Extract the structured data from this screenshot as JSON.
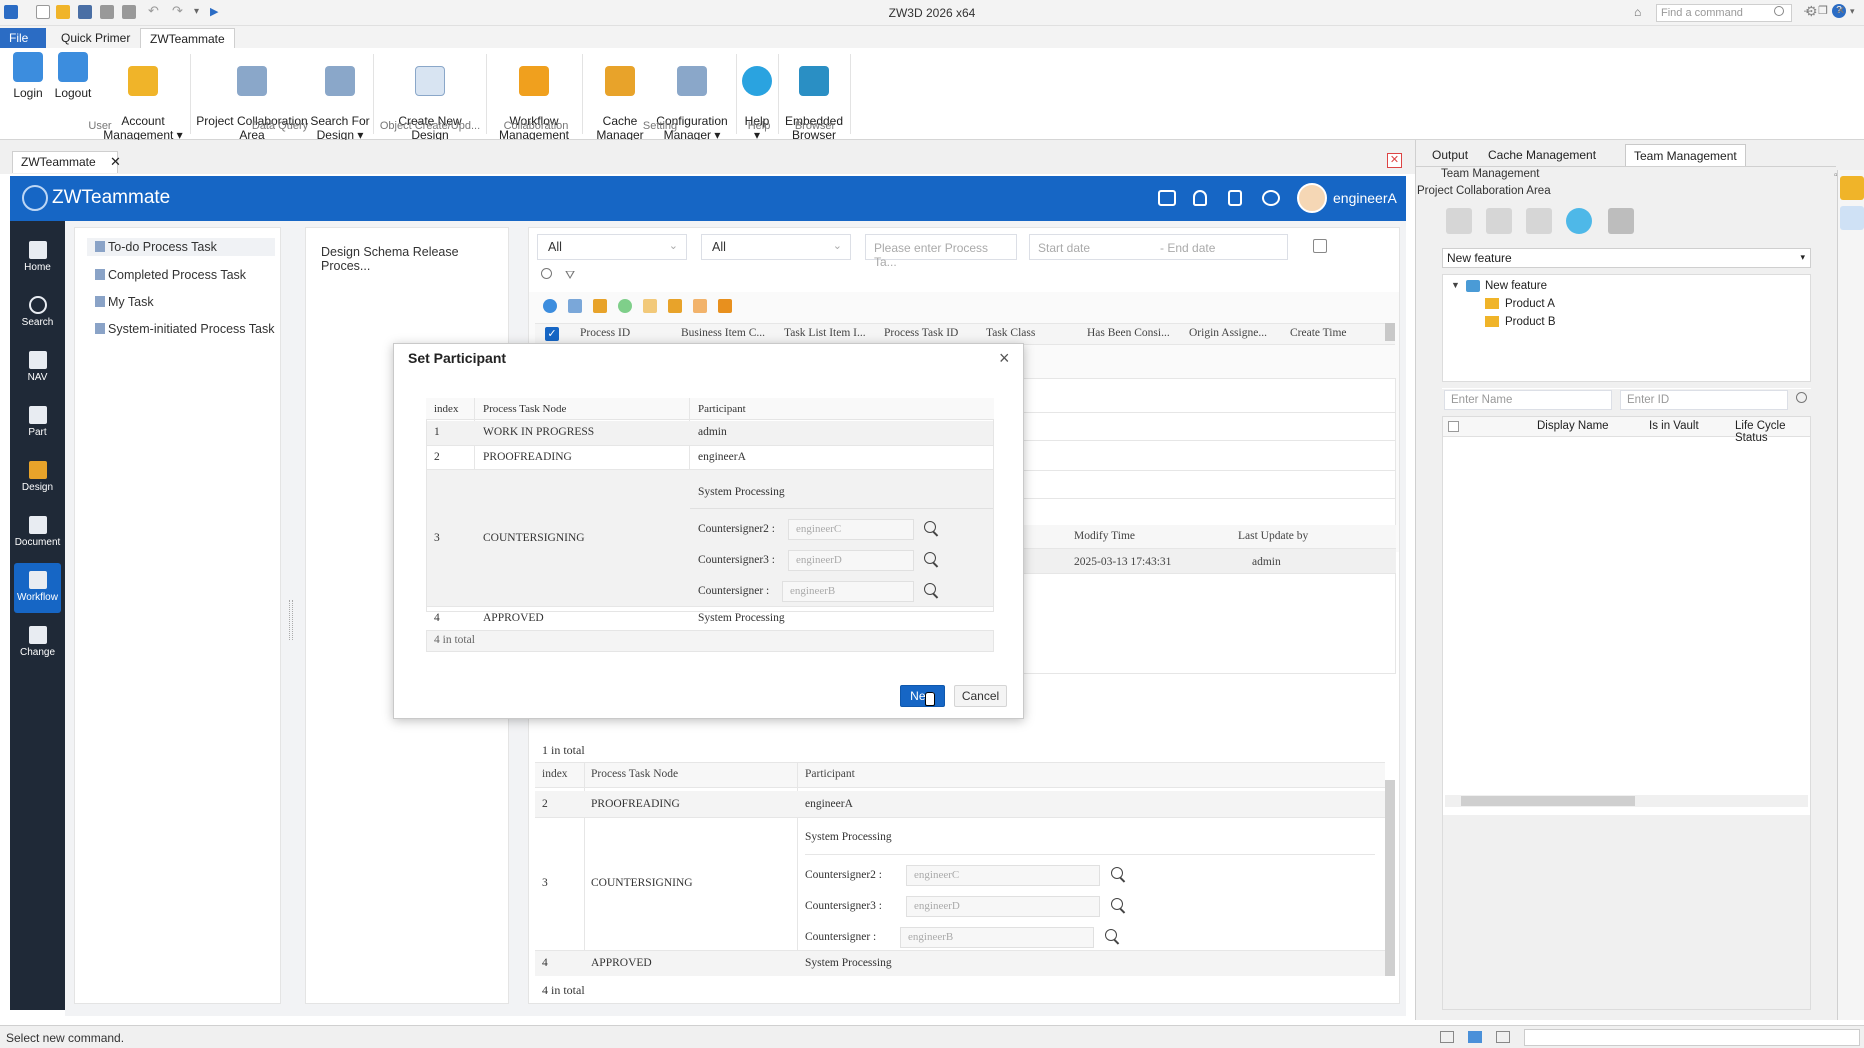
{
  "window": {
    "title": "ZW3D 2026  x64",
    "find_placeholder": "Find a command"
  },
  "menu_tabs": [
    "File",
    "Quick Primer",
    "ZWTeammate"
  ],
  "ribbon": {
    "buttons": [
      {
        "label": "Login"
      },
      {
        "label": "Logout"
      },
      {
        "label": "Account\nManagement ▾"
      },
      {
        "label": "Project Collaboration\nArea"
      },
      {
        "label": "Search For\nDesign ▾"
      },
      {
        "label": "Create New Design\nFrom Template"
      },
      {
        "label": "Workflow\nManagement"
      },
      {
        "label": "Cache\nManager"
      },
      {
        "label": "Configuration\nManager ▾"
      },
      {
        "label": "Help\n▾"
      },
      {
        "label": "Embedded\nBrowser"
      }
    ],
    "groups": [
      "User",
      "Data Query",
      "Object Create/Upd...",
      "Collaboration",
      "Setting",
      "Help",
      "Browser"
    ]
  },
  "doc_tab": {
    "label": "ZWTeammate",
    "close": "✕"
  },
  "app": {
    "name": "ZWTeammate",
    "user": "engineerA"
  },
  "nav": [
    "Home",
    "Search",
    "NAV",
    "Part",
    "Design",
    "Document",
    "Workflow",
    "Change"
  ],
  "task_tree": [
    "To-do Process Task",
    "Completed Process Task",
    "My Task",
    "System-initiated Process Task"
  ],
  "process_panel": {
    "item": "Design Schema Release Proces..."
  },
  "filters": {
    "select1": "All",
    "select2": "All",
    "process_placeholder": "Please enter Process Ta...",
    "start_placeholder": "Start date",
    "end_placeholder": "- End date"
  },
  "task_table": {
    "headers": [
      "Process ID",
      "Business Item C...",
      "Task List Item I...",
      "Process Task ID",
      "Task Class",
      "Has Been Consi...",
      "Origin Assigne...",
      "Create Time"
    ]
  },
  "detail_table": {
    "headers": [
      "Modify Time",
      "Last Update by"
    ],
    "row": [
      "2025-03-13 17:43:31",
      "admin"
    ]
  },
  "bottom": {
    "total1": "1 in total",
    "headers": [
      "index",
      "Process Task Node",
      "Participant"
    ],
    "rows": [
      {
        "index": "2",
        "node": "PROOFREADING",
        "participant": "engineerA"
      },
      {
        "index": "3",
        "node": "COUNTERSIGNING",
        "participant": "System Processing"
      },
      {
        "index": "4",
        "node": "APPROVED",
        "participant": "System Processing"
      }
    ],
    "countersigners": [
      {
        "label": "Countersigner2 :",
        "value": "engineerC"
      },
      {
        "label": "Countersigner3 :",
        "value": "engineerD"
      },
      {
        "label": "Countersigner :",
        "value": "engineerB"
      }
    ],
    "total2": "4 in total"
  },
  "modal": {
    "title": "Set Participant",
    "headers": [
      "index",
      "Process Task Node",
      "Participant"
    ],
    "rows": [
      {
        "index": "1",
        "node": "WORK IN PROGRESS",
        "participant": "admin"
      },
      {
        "index": "2",
        "node": "PROOFREADING",
        "participant": "engineerA"
      },
      {
        "index": "3",
        "node": "COUNTERSIGNING",
        "participant": "System Processing"
      },
      {
        "index": "4",
        "node": "APPROVED",
        "participant": "System Processing"
      }
    ],
    "countersigners": [
      {
        "label": "Countersigner2 :",
        "value": "engineerC"
      },
      {
        "label": "Countersigner3 :",
        "value": "engineerD"
      },
      {
        "label": "Countersigner :",
        "value": "engineerB"
      }
    ],
    "total": "4 in total",
    "next": "Next",
    "cancel": "Cancel"
  },
  "dock": {
    "tabs": [
      "Output",
      "Cache Management",
      "Team Management"
    ],
    "header": "Team Management",
    "subheader": "Project Collaboration Area",
    "feature_select": "New feature",
    "tree": [
      "New feature",
      "Product A",
      "Product B"
    ],
    "name_placeholder": "Enter Name",
    "id_placeholder": "Enter ID",
    "columns": [
      "Display Name",
      "Is in Vault",
      "Life Cycle Status"
    ]
  },
  "status": {
    "text": "Select new command."
  },
  "colors": {
    "brand": "#1666c5",
    "nav_bg": "#1f2937",
    "accent_file": "#2b6cc4"
  }
}
